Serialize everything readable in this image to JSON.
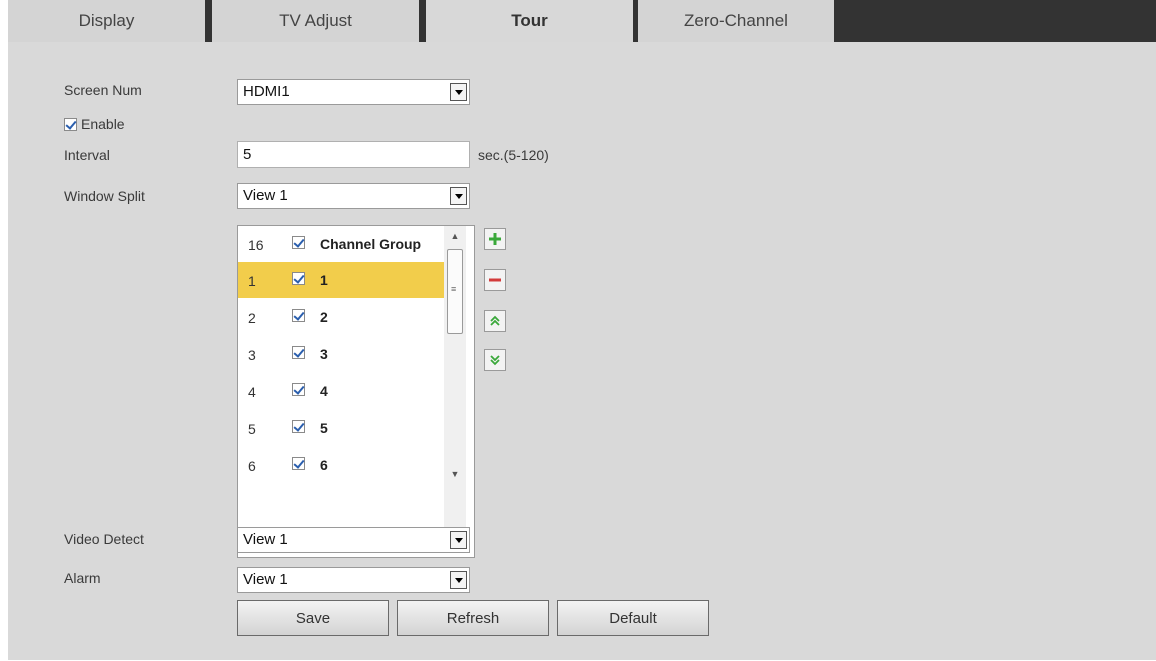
{
  "tabs": [
    {
      "label": "Display"
    },
    {
      "label": "TV Adjust"
    },
    {
      "label": "Tour"
    },
    {
      "label": "Zero-Channel"
    }
  ],
  "form": {
    "screen_num_label": "Screen Num",
    "screen_num_value": "HDMI1",
    "enable_label": "Enable",
    "enable_checked": true,
    "interval_label": "Interval",
    "interval_value": "5",
    "interval_unit": "sec.(5-120)",
    "window_split_label": "Window Split",
    "window_split_value": "View 1",
    "video_detect_label": "Video Detect",
    "video_detect_value": "View 1",
    "alarm_label": "Alarm",
    "alarm_value": "View 1"
  },
  "channel_list": {
    "rows": [
      {
        "num": "16",
        "name": "Channel Group",
        "checked": true,
        "selected": false
      },
      {
        "num": "1",
        "name": "1",
        "checked": true,
        "selected": true
      },
      {
        "num": "2",
        "name": "2",
        "checked": true,
        "selected": false
      },
      {
        "num": "3",
        "name": "3",
        "checked": true,
        "selected": false
      },
      {
        "num": "4",
        "name": "4",
        "checked": true,
        "selected": false
      },
      {
        "num": "5",
        "name": "5",
        "checked": true,
        "selected": false
      },
      {
        "num": "6",
        "name": "6",
        "checked": true,
        "selected": false
      }
    ]
  },
  "list_actions": {
    "add_icon": "plus-icon",
    "remove_icon": "minus-icon",
    "move_up_icon": "double-chevron-up-icon",
    "move_down_icon": "double-chevron-down-icon"
  },
  "buttons": {
    "save": "Save",
    "refresh": "Refresh",
    "default": "Default"
  },
  "colors": {
    "selected_row": "#f2cd4b",
    "panel_bg": "#d9d9d9",
    "tabbar_bg": "#333333",
    "add_green": "#3aa83a",
    "remove_red": "#d33b3b",
    "move_green": "#3aa83a"
  }
}
